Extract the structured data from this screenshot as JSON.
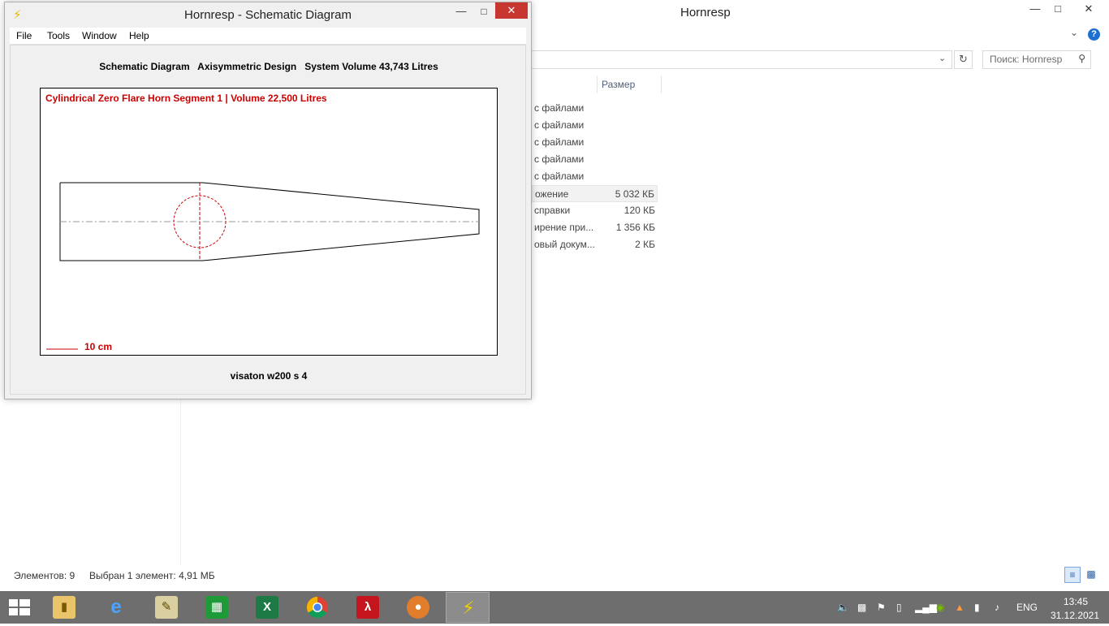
{
  "explorer": {
    "title": "Hornresp",
    "search_placeholder": "Поиск: Hornresp",
    "size_column": "Размер",
    "files": [
      {
        "type": "с файлами",
        "size": ""
      },
      {
        "type": "с файлами",
        "size": ""
      },
      {
        "type": "с файлами",
        "size": ""
      },
      {
        "type": "с файлами",
        "size": ""
      },
      {
        "type": "с файлами",
        "size": ""
      },
      {
        "type": "ожение",
        "size": "5 032 КБ",
        "selected": true
      },
      {
        "type": "справки",
        "size": "120 КБ"
      },
      {
        "type": "ирение при...",
        "size": "1 356 КБ"
      },
      {
        "type": "овый докум...",
        "size": "2 КБ"
      }
    ],
    "status_count": "Элементов: 9",
    "status_selected": "Выбран 1 элемент: 4,91 МБ"
  },
  "hornresp": {
    "title": "Hornresp - Schematic Diagram",
    "menu": [
      "File",
      "Tools",
      "Window",
      "Help"
    ],
    "header": "Schematic Diagram   Axisymmetric Design   System Volume 43,743 Litres",
    "segment_label": "Cylindrical Zero Flare Horn Segment 1 | Volume 22,500 Litres",
    "scale_label": "10 cm",
    "driver_label": "visaton w200 s 4",
    "colors": {
      "accent": "#cc0000",
      "outline": "#000000",
      "axis": "#999999"
    }
  },
  "taskbar": {
    "apps": [
      {
        "name": "file-explorer",
        "active": false
      },
      {
        "name": "internet-explorer",
        "active": false
      },
      {
        "name": "notepad-plus",
        "active": false
      },
      {
        "name": "store",
        "active": false
      },
      {
        "name": "excel",
        "active": false
      },
      {
        "name": "chrome",
        "active": false
      },
      {
        "name": "acrobat",
        "active": false
      },
      {
        "name": "color-app",
        "active": false
      },
      {
        "name": "hornresp",
        "active": true
      }
    ],
    "lang": "ENG",
    "time": "13:45",
    "date": "31.12.2021"
  }
}
